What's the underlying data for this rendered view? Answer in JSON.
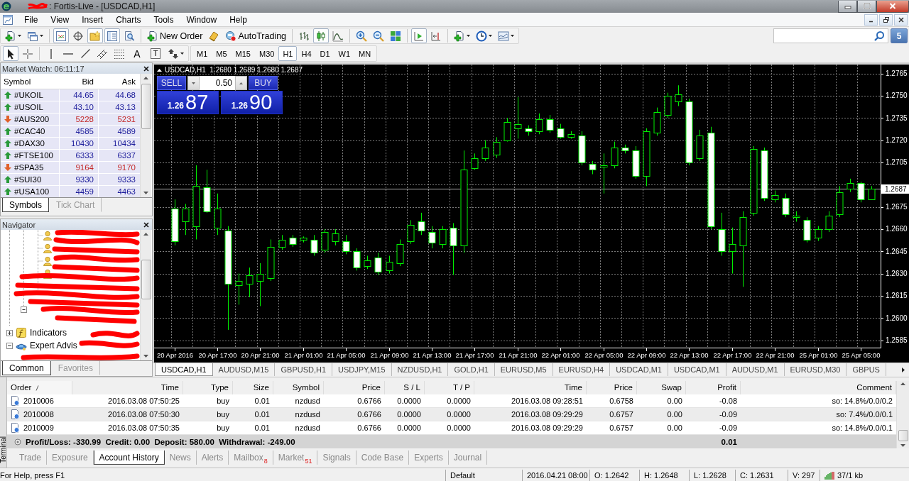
{
  "window": {
    "title": ": Fortis-Live - [USDCAD,H1]"
  },
  "menu": [
    "File",
    "View",
    "Insert",
    "Charts",
    "Tools",
    "Window",
    "Help"
  ],
  "toolbar": {
    "window_toggles": [
      {
        "on": true
      },
      {
        "on": false
      },
      {
        "on": true
      },
      {
        "on": true
      },
      {
        "on": false
      }
    ],
    "new_order": "New Order",
    "autotrading": "AutoTrading",
    "chart_types": [
      {
        "selected": false
      },
      {
        "selected": true
      },
      {
        "selected": false
      }
    ],
    "chart_toggles": [
      {
        "on": true
      },
      {
        "on": false
      }
    ],
    "messages": "5"
  },
  "drawing_toolbar": {
    "tools": [
      {
        "selected": true
      },
      {
        "selected": false
      },
      {
        "selected": false
      },
      {
        "selected": false
      },
      {
        "selected": false
      },
      {
        "selected": false
      },
      {
        "selected": false
      }
    ],
    "text_tools": [
      {
        "label": "A",
        "selected": false
      },
      {
        "label": "T",
        "selected": false
      }
    ],
    "periods": [
      {
        "label": "M1",
        "selected": false
      },
      {
        "label": "M5",
        "selected": false
      },
      {
        "label": "M15",
        "selected": false
      },
      {
        "label": "M30",
        "selected": false
      },
      {
        "label": "H1",
        "selected": true
      },
      {
        "label": "H4",
        "selected": false
      },
      {
        "label": "D1",
        "selected": false
      },
      {
        "label": "W1",
        "selected": false
      },
      {
        "label": "MN",
        "selected": false
      }
    ]
  },
  "market_watch": {
    "title": "Market Watch: 06:11:17",
    "columns": [
      "Symbol",
      "Bid",
      "Ask"
    ],
    "rows": [
      {
        "symbol": "#UKOIL",
        "bid": "44.65",
        "ask": "44.68",
        "rising": true
      },
      {
        "symbol": "#USOIL",
        "bid": "43.10",
        "ask": "43.13",
        "rising": true
      },
      {
        "symbol": "#AUS200",
        "bid": "5228",
        "ask": "5231",
        "rising": false
      },
      {
        "symbol": "#CAC40",
        "bid": "4585",
        "ask": "4589",
        "rising": true
      },
      {
        "symbol": "#DAX30",
        "bid": "10430",
        "ask": "10434",
        "rising": true
      },
      {
        "symbol": "#FTSE100",
        "bid": "6333",
        "ask": "6337",
        "rising": true
      },
      {
        "symbol": "#SPA35",
        "bid": "9164",
        "ask": "9170",
        "rising": false
      },
      {
        "symbol": "#SUI30",
        "bid": "9330",
        "ask": "9333",
        "rising": true
      },
      {
        "symbol": "#USA100",
        "bid": "4459",
        "ask": "4463",
        "rising": true
      }
    ],
    "tabs": [
      {
        "label": "Symbols",
        "selected": true
      },
      {
        "label": "Tick Chart",
        "selected": false
      }
    ]
  },
  "navigator": {
    "title": "Navigator",
    "items": [
      {
        "label": "Indicators",
        "expanded": false
      },
      {
        "label": "Expert Advis",
        "expanded": true
      }
    ],
    "tabs": [
      {
        "label": "Common",
        "selected": true
      },
      {
        "label": "Favorites",
        "selected": false
      }
    ]
  },
  "chart": {
    "info": "USDCAD,H1  1.2680 1.2689 1.2680 1.2687",
    "one_click": {
      "sell_label": "SELL",
      "buy_label": "BUY",
      "volume": "0.50",
      "bid": {
        "prefix": "1.26",
        "pips": "87"
      },
      "ask": {
        "prefix": "1.26",
        "pips": "90"
      }
    },
    "chart_data": {
      "type": "candlestick",
      "grid": true,
      "categories": [
        "20 Apr 2016",
        null,
        null,
        null,
        "20 Apr 17:00",
        null,
        null,
        null,
        "20 Apr 21:00",
        null,
        null,
        null,
        "21 Apr 01:00",
        null,
        null,
        null,
        "21 Apr 05:00",
        null,
        null,
        null,
        "21 Apr 09:00",
        null,
        null,
        null,
        "21 Apr 13:00",
        null,
        null,
        null,
        "21 Apr 17:00",
        null,
        null,
        null,
        "21 Apr 21:00",
        null,
        null,
        null,
        "22 Apr 01:00",
        null,
        null,
        null,
        "22 Apr 05:00",
        null,
        null,
        null,
        "22 Apr 09:00",
        null,
        null,
        null,
        "22 Apr 13:00",
        null,
        null,
        null,
        "22 Apr 17:00",
        null,
        null,
        null,
        "22 Apr 21:00",
        null,
        null,
        null,
        "25 Apr 01:00",
        null,
        null,
        null,
        "25 Apr 05:00",
        null
      ],
      "ohlc": [
        [
          1.2674,
          1.268,
          1.2649,
          1.2652
        ],
        [
          1.2665,
          1.2677,
          1.2656,
          1.2674
        ],
        [
          1.2662,
          1.2703,
          1.2653,
          1.2689
        ],
        [
          1.2688,
          1.27,
          1.2671,
          1.2672
        ],
        [
          1.2661,
          1.2684,
          1.2656,
          1.2674
        ],
        [
          1.2659,
          1.2662,
          1.2592,
          1.2623
        ],
        [
          1.2622,
          1.263,
          1.2609,
          1.2625
        ],
        [
          1.2623,
          1.2634,
          1.2614,
          1.2629
        ],
        [
          1.2625,
          1.2637,
          1.2608,
          1.263
        ],
        [
          1.2627,
          1.2653,
          1.2625,
          1.2648
        ],
        [
          1.2648,
          1.2656,
          1.2646,
          1.2653
        ],
        [
          1.2654,
          1.2656,
          1.2648,
          1.265
        ],
        [
          1.2653,
          1.2655,
          1.2651,
          1.2654
        ],
        [
          1.2653,
          1.2656,
          1.2642,
          1.2644
        ],
        [
          1.2646,
          1.266,
          1.2644,
          1.2658
        ],
        [
          1.2652,
          1.266,
          1.2649,
          1.2657
        ],
        [
          1.2652,
          1.2656,
          1.2643,
          1.2645
        ],
        [
          1.2645,
          1.2647,
          1.2632,
          1.2634
        ],
        [
          1.2635,
          1.2642,
          1.2633,
          1.2639
        ],
        [
          1.2641,
          1.2644,
          1.2629,
          1.2631
        ],
        [
          1.2632,
          1.2642,
          1.263,
          1.2638
        ],
        [
          1.2637,
          1.2653,
          1.2635,
          1.265
        ],
        [
          1.2652,
          1.2666,
          1.265,
          1.2663
        ],
        [
          1.2665,
          1.2671,
          1.2656,
          1.2659
        ],
        [
          1.2658,
          1.2662,
          1.2647,
          1.2651
        ],
        [
          1.265,
          1.2662,
          1.2647,
          1.266
        ],
        [
          1.2661,
          1.2664,
          1.2629,
          1.2649
        ],
        [
          1.2649,
          1.2713,
          1.2644,
          1.27
        ],
        [
          1.2701,
          1.2711,
          1.27,
          1.2708
        ],
        [
          1.2708,
          1.272,
          1.2706,
          1.2715
        ],
        [
          1.271,
          1.2722,
          1.2708,
          1.2719
        ],
        [
          1.272,
          1.2735,
          1.2719,
          1.2732
        ],
        [
          1.2728,
          1.2749,
          1.2721,
          1.2731
        ],
        [
          1.2728,
          1.273,
          1.2723,
          1.2726
        ],
        [
          1.2726,
          1.2738,
          1.2724,
          1.2734
        ],
        [
          1.2734,
          1.2737,
          1.2725,
          1.2727
        ],
        [
          1.2728,
          1.2731,
          1.2721,
          1.2722
        ],
        [
          1.2722,
          1.2726,
          1.2721,
          1.2724
        ],
        [
          1.2723,
          1.2726,
          1.2703,
          1.2705
        ],
        [
          1.2704,
          1.2706,
          1.2697,
          1.27
        ],
        [
          1.2702,
          1.2711,
          1.2684,
          1.2703
        ],
        [
          1.2703,
          1.2719,
          1.2701,
          1.2715
        ],
        [
          1.2715,
          1.2717,
          1.2711,
          1.2713
        ],
        [
          1.2713,
          1.2716,
          1.2694,
          1.2696
        ],
        [
          1.2696,
          1.2728,
          1.2689,
          1.2726
        ],
        [
          1.2725,
          1.2742,
          1.2723,
          1.2739
        ],
        [
          1.2737,
          1.2752,
          1.2735,
          1.275
        ],
        [
          1.2746,
          1.2757,
          1.2743,
          1.2751
        ],
        [
          1.2746,
          1.2748,
          1.2703,
          1.2705
        ],
        [
          1.2708,
          1.2727,
          1.2706,
          1.2723
        ],
        [
          1.2725,
          1.2729,
          1.266,
          1.2662
        ],
        [
          1.266,
          1.2671,
          1.2642,
          1.2645
        ],
        [
          1.2645,
          1.2661,
          1.263,
          1.265
        ],
        [
          1.2649,
          1.2672,
          1.2621,
          1.2668
        ],
        [
          1.2671,
          1.2716,
          1.2669,
          1.2714
        ],
        [
          1.2713,
          1.2715,
          1.2679,
          1.2681
        ],
        [
          1.268,
          1.2686,
          1.2678,
          1.2683
        ],
        [
          1.2681,
          1.2684,
          1.2668,
          1.267
        ],
        [
          1.2668,
          1.2672,
          1.2665,
          1.2669
        ],
        [
          1.2666,
          1.2668,
          1.2651,
          1.2653
        ],
        [
          1.2654,
          1.2662,
          1.2652,
          1.266
        ],
        [
          1.266,
          1.2672,
          1.2658,
          1.2669
        ],
        [
          1.267,
          1.2689,
          1.2668,
          1.2685
        ],
        [
          1.2687,
          1.2694,
          1.2685,
          1.2691
        ],
        [
          1.2691,
          1.2692,
          1.2678,
          1.268
        ],
        [
          1.268,
          1.2689,
          1.268,
          1.2687
        ]
      ],
      "ylim": [
        1.258,
        1.2771
      ],
      "yticks": [
        {
          "value": 1.2765,
          "label": "1.2765"
        },
        {
          "value": 1.275,
          "label": "1.2750"
        },
        {
          "value": 1.2735,
          "label": "1.2735"
        },
        {
          "value": 1.272,
          "label": "1.2720"
        },
        {
          "value": 1.2705,
          "label": "1.2705"
        },
        {
          "value": 1.2675,
          "label": "1.2675"
        },
        {
          "value": 1.266,
          "label": "1.2660"
        },
        {
          "value": 1.2645,
          "label": "1.2645"
        },
        {
          "value": 1.263,
          "label": "1.2630"
        },
        {
          "value": 1.2615,
          "label": "1.2615"
        },
        {
          "value": 1.26,
          "label": "1.2600"
        },
        {
          "value": 1.2585,
          "label": "1.2585"
        }
      ],
      "ref_lines": [
        {
          "axis": "y",
          "value": 1.2687,
          "label": "1.2687"
        }
      ]
    },
    "tabs": [
      {
        "label": "USDCAD,H1",
        "selected": true
      },
      {
        "label": "AUDUSD,M15",
        "selected": false
      },
      {
        "label": "GBPUSD,H1",
        "selected": false
      },
      {
        "label": "USDJPY,M15",
        "selected": false
      },
      {
        "label": "NZDUSD,H1",
        "selected": false
      },
      {
        "label": "GOLD,H1",
        "selected": false
      },
      {
        "label": "EURUSD,M5",
        "selected": false
      },
      {
        "label": "EURUSD,H4",
        "selected": false
      },
      {
        "label": "USDCAD,M1",
        "selected": false
      },
      {
        "label": "USDCAD,M1",
        "selected": false
      },
      {
        "label": "AUDUSD,M1",
        "selected": false
      },
      {
        "label": "EURUSD,M30",
        "selected": false
      },
      {
        "label": "GBPUS",
        "selected": false
      }
    ]
  },
  "terminal": {
    "label": "Terminal",
    "columns": [
      {
        "label": "Order",
        "sorted": true
      },
      {
        "label": "Time",
        "sorted": false
      },
      {
        "label": "Type",
        "sorted": false
      },
      {
        "label": "Size",
        "sorted": false
      },
      {
        "label": "Symbol",
        "sorted": false
      },
      {
        "label": "Price",
        "sorted": false
      },
      {
        "label": "S / L",
        "sorted": false
      },
      {
        "label": "T / P",
        "sorted": false
      },
      {
        "label": "Time",
        "sorted": false
      },
      {
        "label": "Price",
        "sorted": false
      },
      {
        "label": "Swap",
        "sorted": false
      },
      {
        "label": "Profit",
        "sorted": false
      },
      {
        "label": "Comment",
        "sorted": false
      }
    ],
    "rows": [
      {
        "cells": [
          "2010006",
          "2016.03.08 07:50:25",
          "buy",
          "0.01",
          "nzdusd",
          "0.6766",
          "0.0000",
          "0.0000",
          "2016.03.08 09:28:51",
          "0.6758",
          "0.00",
          "-0.08",
          "so: 14.8%/0.0/0.2"
        ]
      },
      {
        "cells": [
          "2010008",
          "2016.03.08 07:50:30",
          "buy",
          "0.01",
          "nzdusd",
          "0.6766",
          "0.0000",
          "0.0000",
          "2016.03.08 09:29:29",
          "0.6757",
          "0.00",
          "-0.09",
          "so: 7.4%/0.0/0.1"
        ]
      },
      {
        "cells": [
          "2010009",
          "2016.03.08 07:50:35",
          "buy",
          "0.01",
          "nzdusd",
          "0.6766",
          "0.0000",
          "0.0000",
          "2016.03.08 09:29:29",
          "0.6757",
          "0.00",
          "-0.09",
          "so: 14.8%/0.0/0.1"
        ]
      }
    ],
    "summary": {
      "text": "Profit/Loss: -330.99  Credit: 0.00  Deposit: 580.00  Withdrawal: -249.00",
      "profit": "0.01"
    },
    "tabs": [
      {
        "label": "Trade",
        "selected": false
      },
      {
        "label": "Exposure",
        "selected": false
      },
      {
        "label": "Account History",
        "selected": true
      },
      {
        "label": "News",
        "selected": false
      },
      {
        "label": "Alerts",
        "selected": false
      },
      {
        "label": "Mailbox",
        "selected": false,
        "badge": "8"
      },
      {
        "label": "Market",
        "selected": false,
        "badge": "51"
      },
      {
        "label": "Signals",
        "selected": false
      },
      {
        "label": "Code Base",
        "selected": false
      },
      {
        "label": "Experts",
        "selected": false
      },
      {
        "label": "Journal",
        "selected": false
      }
    ]
  },
  "status_bar": {
    "help": "For Help, press F1",
    "profile": "Default",
    "datetime": "2016.04.21 08:00",
    "open": "O: 1.2642",
    "high": "H: 1.2648",
    "low": "L: 1.2628",
    "close": "C: 1.2631",
    "volume": "V: 297",
    "traffic": "37/1 kb"
  }
}
